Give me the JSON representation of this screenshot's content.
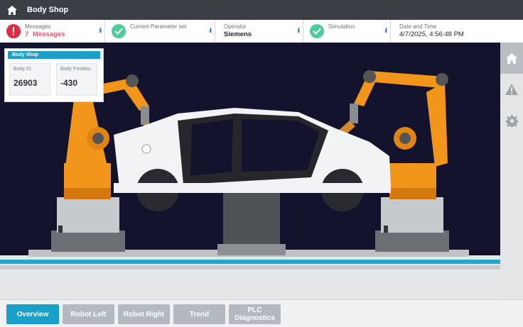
{
  "header": {
    "title": "Body Shop",
    "home_icon": "home-icon"
  },
  "status": {
    "messages": {
      "label": "Messages",
      "count": "7",
      "value": "Messages",
      "icon": "alert-icon",
      "color": "#e32b45"
    },
    "parameter": {
      "label": "Current Parameter set",
      "icon": "check-icon",
      "color": "#4ecb9a"
    },
    "operator": {
      "label": "Operator",
      "value": "Siemens"
    },
    "simulation": {
      "label": "Simulation",
      "icon": "check-icon",
      "color": "#4ecb9a"
    },
    "datetime": {
      "label": "Date and Time",
      "value": "4/7/2025, 4:56:48 PM"
    },
    "arrow_glyph": "›I"
  },
  "info_panel": {
    "title": "Body Shop",
    "body_id": {
      "label": "Body ID",
      "value": "26903"
    },
    "body_position": {
      "label": "Body Position",
      "value": "-430"
    }
  },
  "right_nav": [
    "home-icon",
    "warning-icon",
    "gear-icon"
  ],
  "tabs": [
    {
      "label": "Overview",
      "active": true
    },
    {
      "label": "Robot Left",
      "active": false
    },
    {
      "label": "Robot Right",
      "active": false
    },
    {
      "label": "Trend",
      "active": false
    },
    {
      "label": "PLC Diagnostics",
      "active": false
    }
  ],
  "colors": {
    "accent": "#1aa0c8",
    "robot": "#f2961b",
    "scene_bg": "#14132e"
  }
}
